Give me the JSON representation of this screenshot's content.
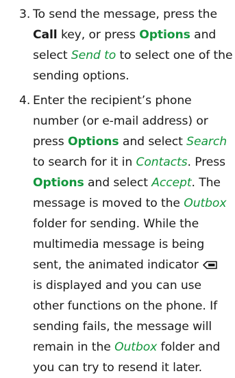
{
  "steps": [
    {
      "number": "3.",
      "lines": [
        [
          {
            "t": "To send the message, press the",
            "s": "plain"
          }
        ],
        [
          {
            "t": "Call",
            "s": "kw"
          },
          {
            "t": " key, or press ",
            "s": "plain"
          },
          {
            "t": "Options",
            "s": "opt"
          },
          {
            "t": " and",
            "s": "plain"
          }
        ],
        [
          {
            "t": "select ",
            "s": "plain"
          },
          {
            "t": "Send to",
            "s": "menu"
          },
          {
            "t": " to select one of the",
            "s": "plain"
          }
        ],
        [
          {
            "t": "sending options.",
            "s": "plain"
          }
        ]
      ]
    },
    {
      "number": "4.",
      "lines": [
        [
          {
            "t": "Enter the recipient’s phone",
            "s": "plain"
          }
        ],
        [
          {
            "t": "number (or e-mail address) or",
            "s": "plain"
          }
        ],
        [
          {
            "t": "press ",
            "s": "plain"
          },
          {
            "t": "Options",
            "s": "opt"
          },
          {
            "t": " and select ",
            "s": "plain"
          },
          {
            "t": "Search",
            "s": "menu"
          }
        ],
        [
          {
            "t": "to search for it in ",
            "s": "plain"
          },
          {
            "t": "Contacts",
            "s": "menu"
          },
          {
            "t": ". Press",
            "s": "plain"
          }
        ],
        [
          {
            "t": "Options",
            "s": "opt"
          },
          {
            "t": " and select ",
            "s": "plain"
          },
          {
            "t": "Accept",
            "s": "menu"
          },
          {
            "t": ". The",
            "s": "plain"
          }
        ],
        [
          {
            "t": "message is moved to the ",
            "s": "plain"
          },
          {
            "t": "Outbox",
            "s": "menu"
          }
        ],
        [
          {
            "t": "folder for sending. While the",
            "s": "plain"
          }
        ],
        [
          {
            "t": "multimedia message is being",
            "s": "plain"
          }
        ],
        [
          {
            "t": "sent, the animated indicator",
            "s": "plain"
          },
          {
            "icon": "sending-indicator-icon"
          }
        ],
        [
          {
            "t": "is displayed and you can use",
            "s": "plain"
          }
        ],
        [
          {
            "t": "other functions on the phone. If",
            "s": "plain"
          }
        ],
        [
          {
            "t": "sending fails, the message will",
            "s": "plain"
          }
        ],
        [
          {
            "t": "remain in the ",
            "s": "plain"
          },
          {
            "t": "Outbox",
            "s": "menu"
          },
          {
            "t": " folder and",
            "s": "plain"
          }
        ],
        [
          {
            "t": "you can try to resend it later.",
            "s": "plain"
          }
        ]
      ]
    }
  ],
  "colors": {
    "text": "#1a1a1a",
    "accent_green": "#12963c"
  }
}
